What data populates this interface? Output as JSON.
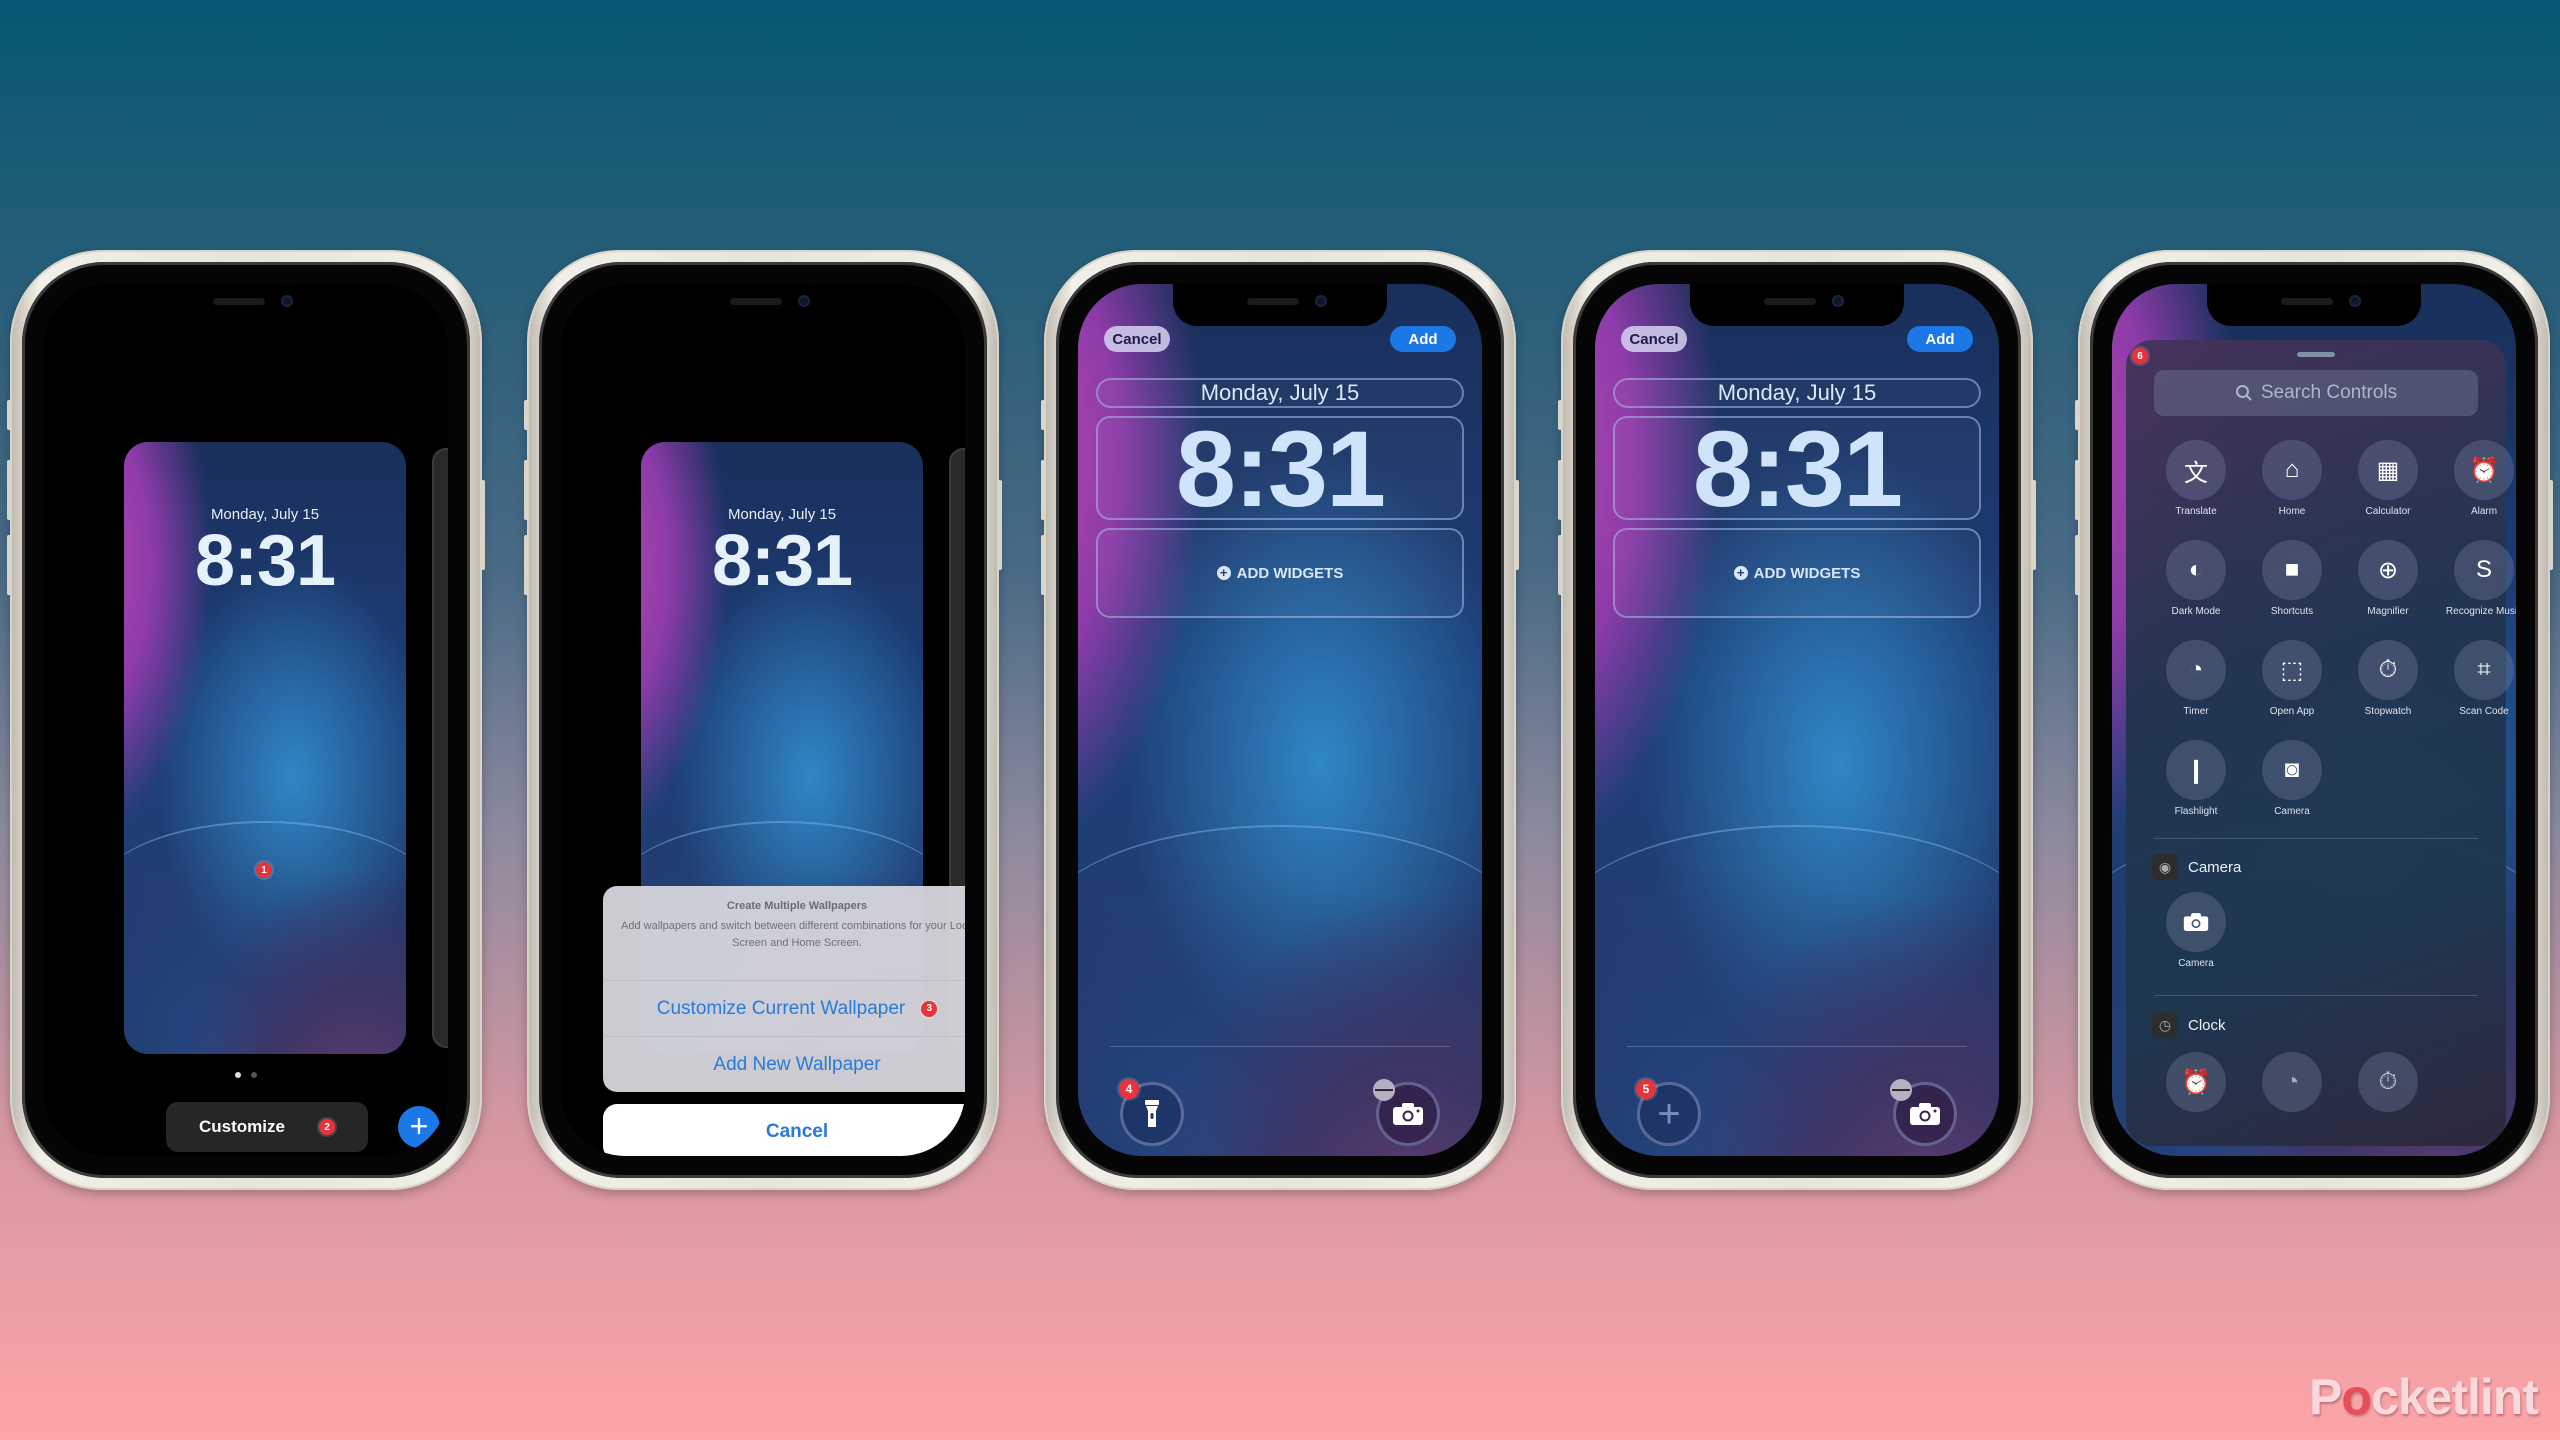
{
  "lock_date": "Monday, July 15",
  "lock_time": "8:31",
  "badges": [
    "1",
    "2",
    "3",
    "4",
    "5",
    "6"
  ],
  "phone1": {
    "customize_label": "Customize",
    "add_icon": "plus-icon",
    "page_dots": 2,
    "active_dot": 1
  },
  "phone2": {
    "sheet_title": "Create Multiple Wallpapers",
    "sheet_message": "Add wallpapers and switch between different combinations for your Lock Screen and Home Screen.",
    "customize_current": "Customize Current Wallpaper",
    "add_new": "Add New Wallpaper",
    "cancel": "Cancel"
  },
  "editor": {
    "cancel": "Cancel",
    "add": "Add",
    "add_widgets": "ADD WIDGETS",
    "left_control_icon": "flashlight-icon",
    "right_control_icon": "camera-icon",
    "remove_symbol": "—"
  },
  "phone5": {
    "search_placeholder": "Search Controls",
    "controls": [
      {
        "label": "Translate",
        "icon": "translate-icon"
      },
      {
        "label": "Home",
        "icon": "home-icon"
      },
      {
        "label": "Calculator",
        "icon": "calculator-icon"
      },
      {
        "label": "Alarm",
        "icon": "alarm-icon"
      },
      {
        "label": "Dark Mode",
        "icon": "dark-mode-icon"
      },
      {
        "label": "Shortcuts",
        "icon": "video-icon"
      },
      {
        "label": "Magnifier",
        "icon": "magnifier-icon"
      },
      {
        "label": "Recognize Music",
        "icon": "shazam-icon"
      },
      {
        "label": "Timer",
        "icon": "timer-icon"
      },
      {
        "label": "Open App",
        "icon": "open-app-icon"
      },
      {
        "label": "Stopwatch",
        "icon": "stopwatch-icon"
      },
      {
        "label": "Scan Code",
        "icon": "qr-code-icon"
      },
      {
        "label": "Flashlight",
        "icon": "flashlight-icon"
      },
      {
        "label": "Camera",
        "icon": "camera-icon"
      }
    ],
    "sections": [
      {
        "title": "Camera",
        "controls": [
          {
            "label": "Camera",
            "icon": "camera-icon"
          }
        ]
      },
      {
        "title": "Clock",
        "controls": [
          {
            "label": "",
            "icon": "alarm-icon"
          },
          {
            "label": "",
            "icon": "timer-icon"
          },
          {
            "label": "",
            "icon": "stopwatch-icon"
          }
        ]
      }
    ]
  },
  "watermark": {
    "prefix": "P",
    "o": "o",
    "suffix": "cketlint"
  },
  "colors": {
    "accent_blue": "#1b78e6",
    "badge_red": "#e8323c",
    "link_blue": "#2a7ad8"
  }
}
